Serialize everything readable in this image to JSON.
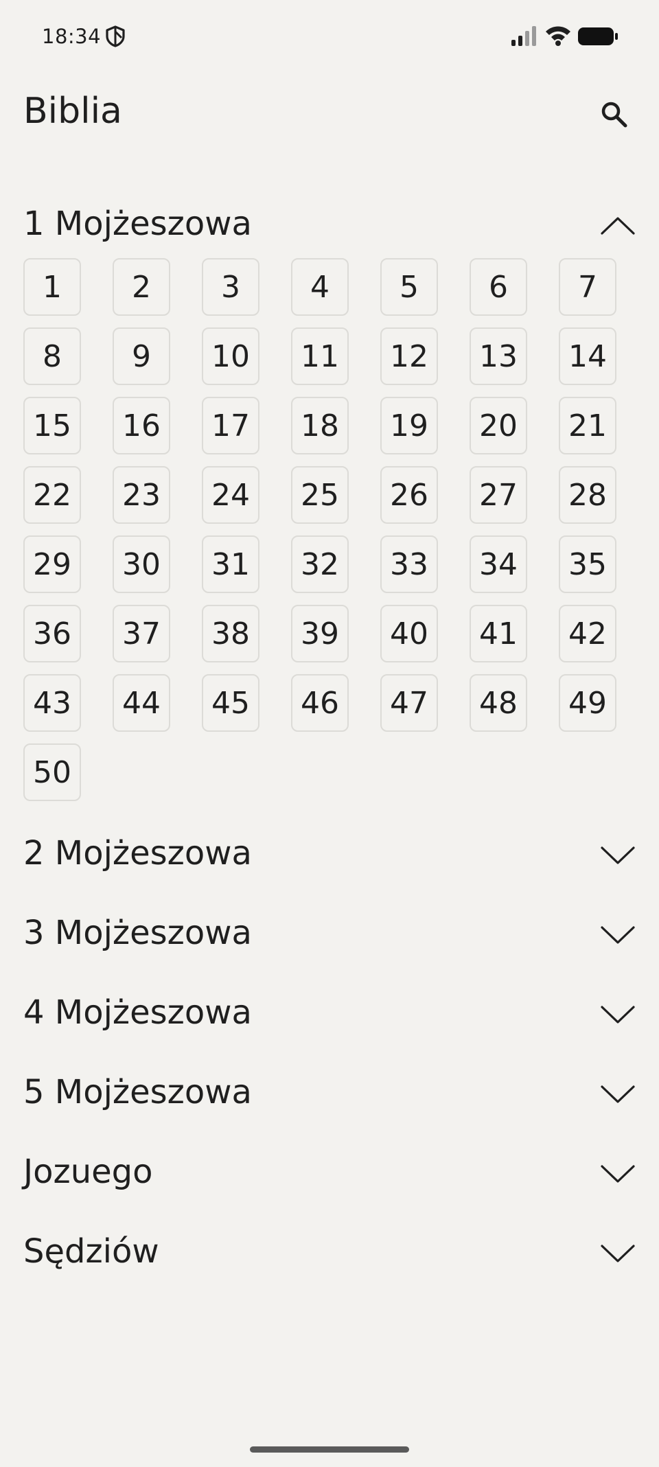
{
  "status_bar": {
    "time": "18:34"
  },
  "header": {
    "title": "Biblia"
  },
  "books": [
    {
      "title": "1 Mojżeszowa",
      "expanded": true,
      "chapters": [
        "1",
        "2",
        "3",
        "4",
        "5",
        "6",
        "7",
        "8",
        "9",
        "10",
        "11",
        "12",
        "13",
        "14",
        "15",
        "16",
        "17",
        "18",
        "19",
        "20",
        "21",
        "22",
        "23",
        "24",
        "25",
        "26",
        "27",
        "28",
        "29",
        "30",
        "31",
        "32",
        "33",
        "34",
        "35",
        "36",
        "37",
        "38",
        "39",
        "40",
        "41",
        "42",
        "43",
        "44",
        "45",
        "46",
        "47",
        "48",
        "49",
        "50"
      ]
    },
    {
      "title": "2 Mojżeszowa",
      "expanded": false
    },
    {
      "title": "3 Mojżeszowa",
      "expanded": false
    },
    {
      "title": "4 Mojżeszowa",
      "expanded": false
    },
    {
      "title": "5 Mojżeszowa",
      "expanded": false
    },
    {
      "title": "Jozuego",
      "expanded": false
    },
    {
      "title": "Sędziów",
      "expanded": false
    }
  ]
}
